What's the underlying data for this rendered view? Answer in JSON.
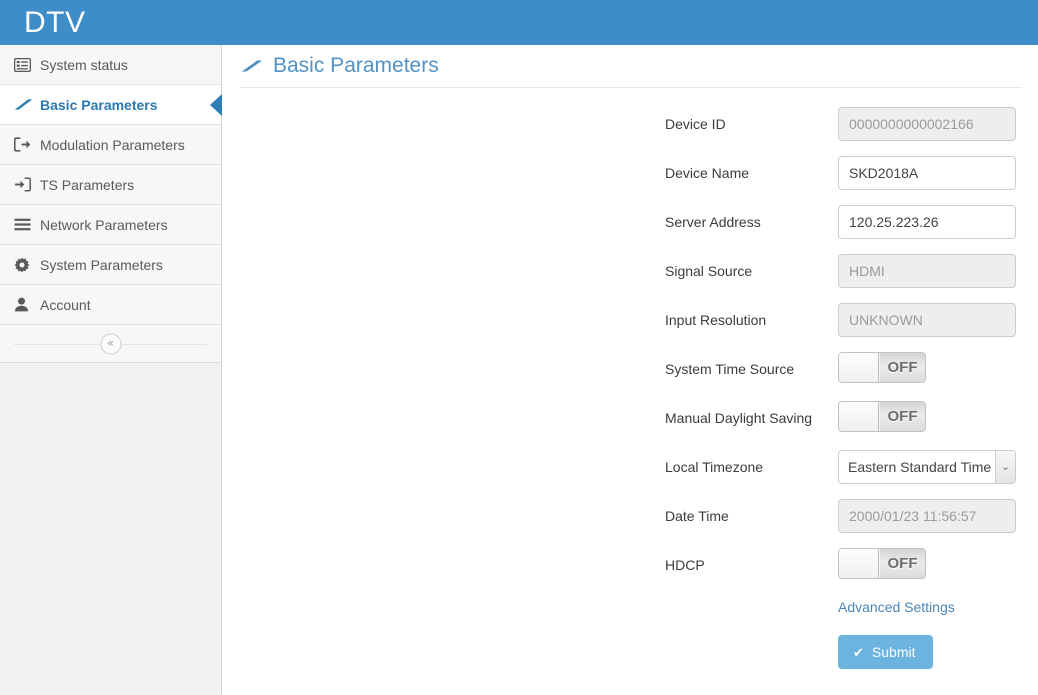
{
  "header": {
    "brand": "DTV",
    "brand_bg": "#3e8cc8"
  },
  "sidebar": {
    "items": [
      {
        "label": "System status",
        "icon": "list-alt-icon",
        "active": false
      },
      {
        "label": "Basic Parameters",
        "icon": "eraser-icon",
        "active": true
      },
      {
        "label": "Modulation Parameters",
        "icon": "sign-out-icon",
        "active": false
      },
      {
        "label": "TS Parameters",
        "icon": "sign-in-icon",
        "active": false
      },
      {
        "label": "Network Parameters",
        "icon": "bars-icon",
        "active": false
      },
      {
        "label": "System Parameters",
        "icon": "gear-icon",
        "active": false
      },
      {
        "label": "Account",
        "icon": "user-icon",
        "active": false
      }
    ],
    "collapse_label": "«",
    "active_accent": "#2e7db4"
  },
  "page": {
    "title": "Basic Parameters",
    "title_color": "#5292c4",
    "title_icon": "eraser-icon"
  },
  "form": {
    "fields": [
      {
        "label": "Device ID",
        "type": "text",
        "value": "0000000000002166",
        "disabled": true
      },
      {
        "label": "Device Name",
        "type": "text",
        "value": "SKD2018A",
        "disabled": false
      },
      {
        "label": "Server Address",
        "type": "text",
        "value": "120.25.223.26",
        "disabled": false
      },
      {
        "label": "Signal Source",
        "type": "text",
        "value": "HDMI",
        "disabled": true
      },
      {
        "label": "Input Resolution",
        "type": "text",
        "value": "UNKNOWN",
        "disabled": true
      },
      {
        "label": "System Time Source",
        "type": "toggle",
        "value": "OFF",
        "disabled": false
      },
      {
        "label": "Manual Daylight Saving",
        "type": "toggle",
        "value": "OFF",
        "disabled": false
      },
      {
        "label": "Local Timezone",
        "type": "select",
        "value": "Eastern Standard Time",
        "disabled": false
      },
      {
        "label": "Date Time",
        "type": "text",
        "value": "2000/01/23 11:56:57",
        "disabled": true
      },
      {
        "label": "HDCP",
        "type": "toggle",
        "value": "OFF",
        "disabled": false
      }
    ],
    "advanced_settings_label": "Advanced Settings",
    "submit_label": "Submit",
    "submit_icon": "check-icon",
    "submit_color": "#6cb3e0"
  }
}
